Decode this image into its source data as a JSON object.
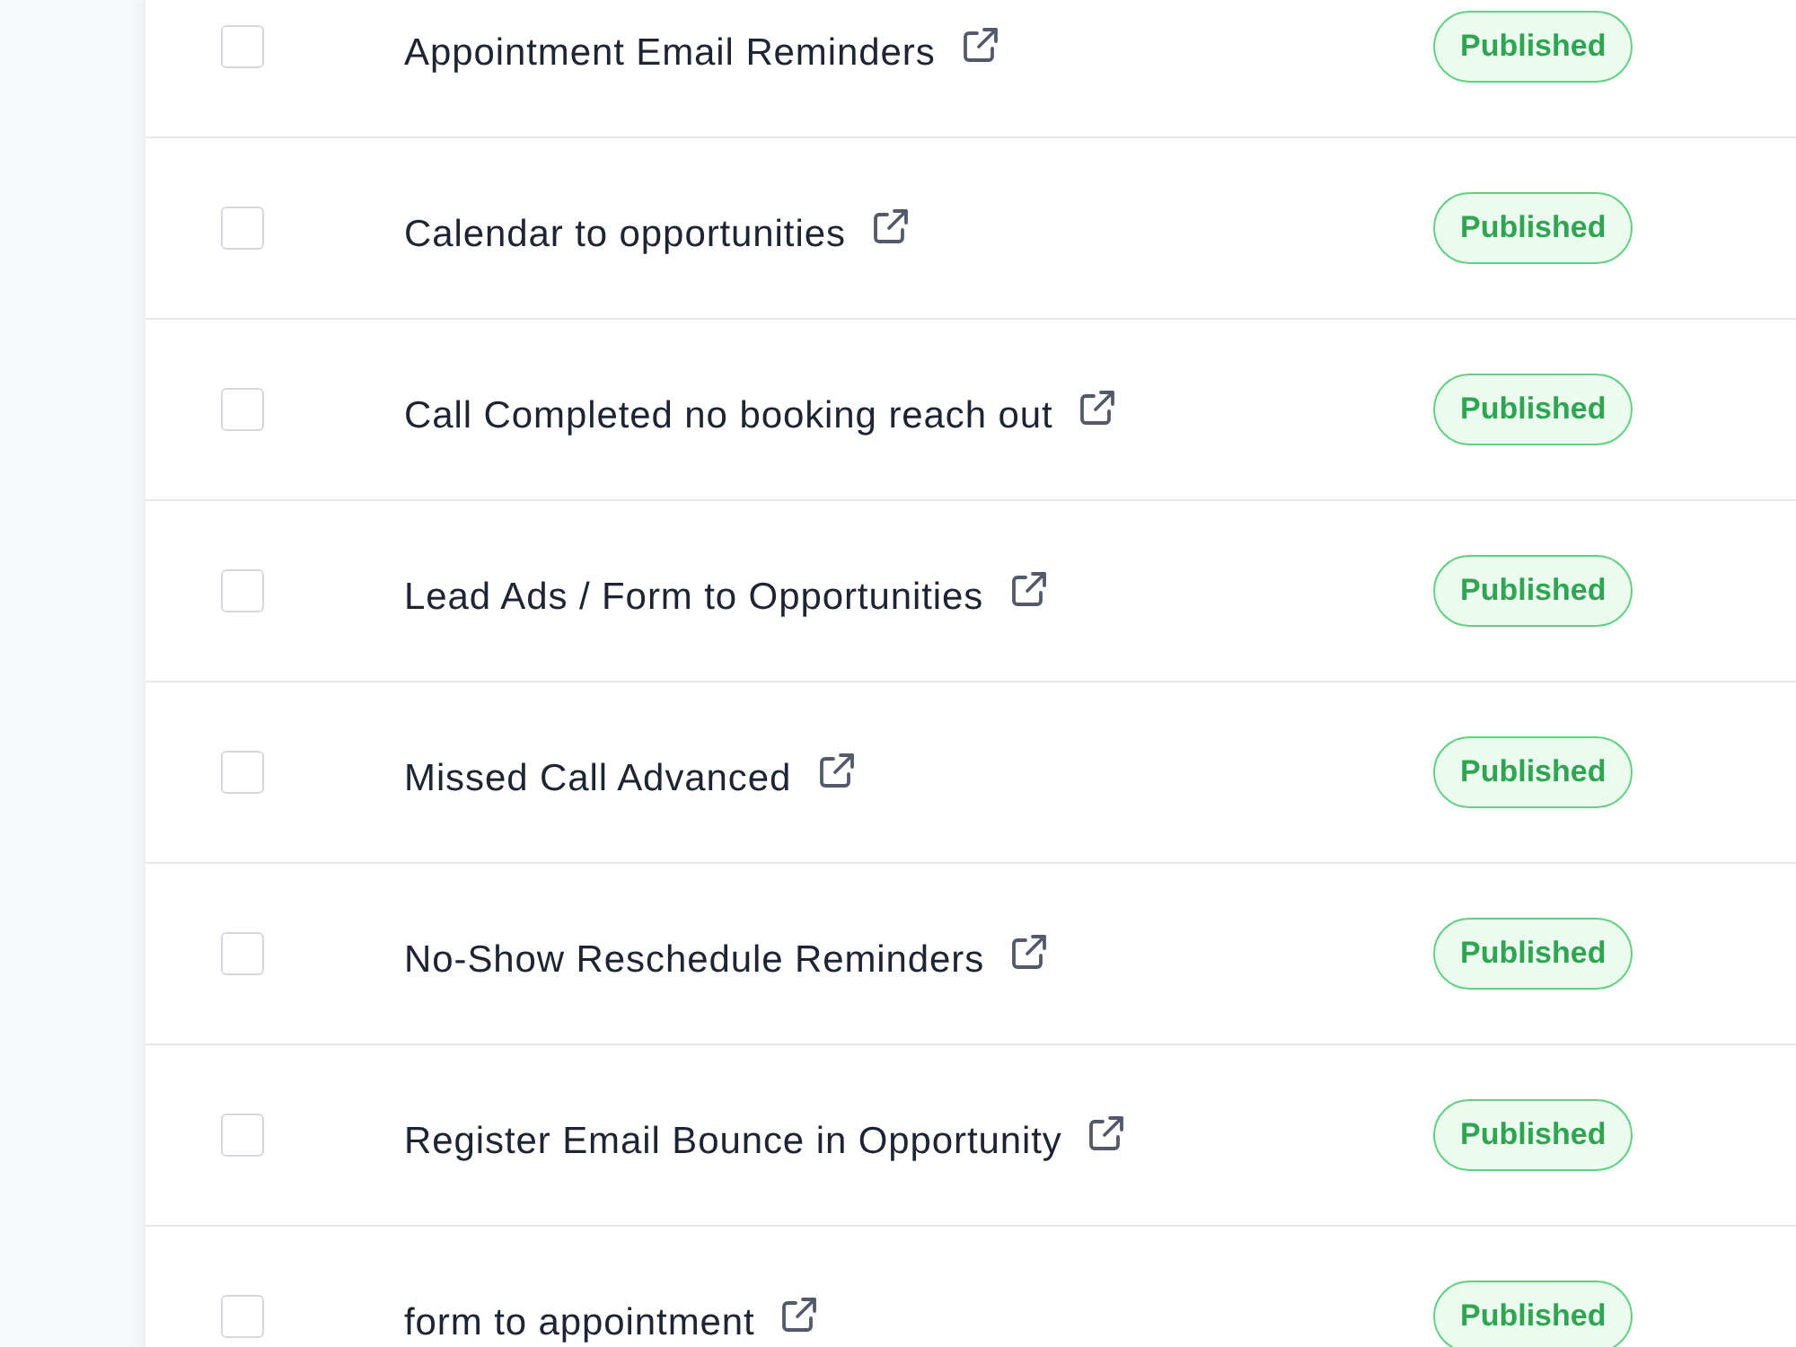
{
  "rows": [
    {
      "name": "Appointment Email Reminders",
      "checked": false,
      "status": "Published"
    },
    {
      "name": "Calendar to opportunities",
      "checked": false,
      "status": "Published"
    },
    {
      "name": "Call Completed no booking reach out",
      "checked": false,
      "status": "Published"
    },
    {
      "name": "Lead Ads / Form to Opportunities",
      "checked": false,
      "status": "Published"
    },
    {
      "name": "Missed Call Advanced",
      "checked": false,
      "status": "Published"
    },
    {
      "name": "No-Show Reschedule Reminders",
      "checked": false,
      "status": "Published"
    },
    {
      "name": "Register Email Bounce in Opportunity",
      "checked": false,
      "status": "Published"
    },
    {
      "name": "form to appointment",
      "checked": false,
      "status": "Published"
    }
  ]
}
